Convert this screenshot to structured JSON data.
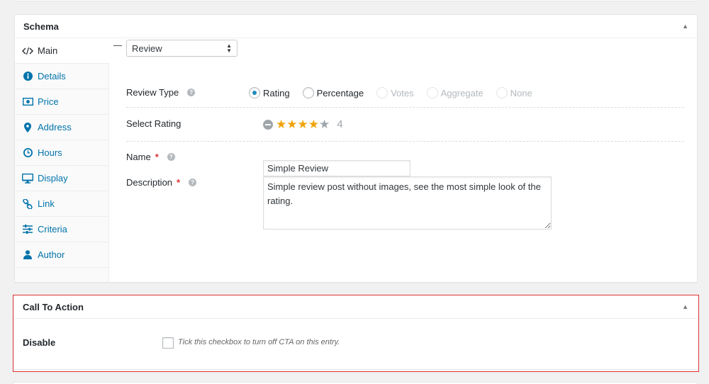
{
  "schema_box": {
    "title": "Schema",
    "toggle_glyph": "▲",
    "tabs": [
      {
        "label": "Main",
        "icon": "code-icon"
      },
      {
        "label": "Details",
        "icon": "info-icon"
      },
      {
        "label": "Price",
        "icon": "money-icon"
      },
      {
        "label": "Address",
        "icon": "map-marker-icon"
      },
      {
        "label": "Hours",
        "icon": "clock-icon"
      },
      {
        "label": "Display",
        "icon": "monitor-icon"
      },
      {
        "label": "Link",
        "icon": "link-icon"
      },
      {
        "label": "Criteria",
        "icon": "sliders-icon"
      },
      {
        "label": "Author",
        "icon": "user-icon"
      }
    ],
    "active_tab": "Main",
    "schema_type_select": {
      "value": "Review"
    },
    "review_type": {
      "label": "Review Type",
      "options": [
        {
          "label": "Rating",
          "selected": true,
          "disabled": false
        },
        {
          "label": "Percentage",
          "selected": false,
          "disabled": false
        },
        {
          "label": "Votes",
          "selected": false,
          "disabled": true
        },
        {
          "label": "Aggregate",
          "selected": false,
          "disabled": true
        },
        {
          "label": "None",
          "selected": false,
          "disabled": true
        }
      ]
    },
    "select_rating": {
      "label": "Select Rating",
      "value": "4",
      "max": 5
    },
    "name_field": {
      "label": "Name",
      "required_mark": "*",
      "value": "Simple Review"
    },
    "description_field": {
      "label": "Description",
      "required_mark": "*",
      "value": "Simple review post without images, see the most simple look of the rating."
    },
    "help_glyph": "?"
  },
  "cta_box": {
    "title": "Call To Action",
    "toggle_glyph": "▲",
    "disable_label": "Disable",
    "disable_checked": false,
    "disable_description": "Tick this checkbox to turn off CTA on this entry."
  },
  "colors": {
    "link": "#0073aa",
    "star_on": "#f0a30a",
    "star_off": "#a0a5aa",
    "required": "#dc3232",
    "highlight_border": "#dc3232",
    "radio_dot": "#1e8cbe"
  }
}
